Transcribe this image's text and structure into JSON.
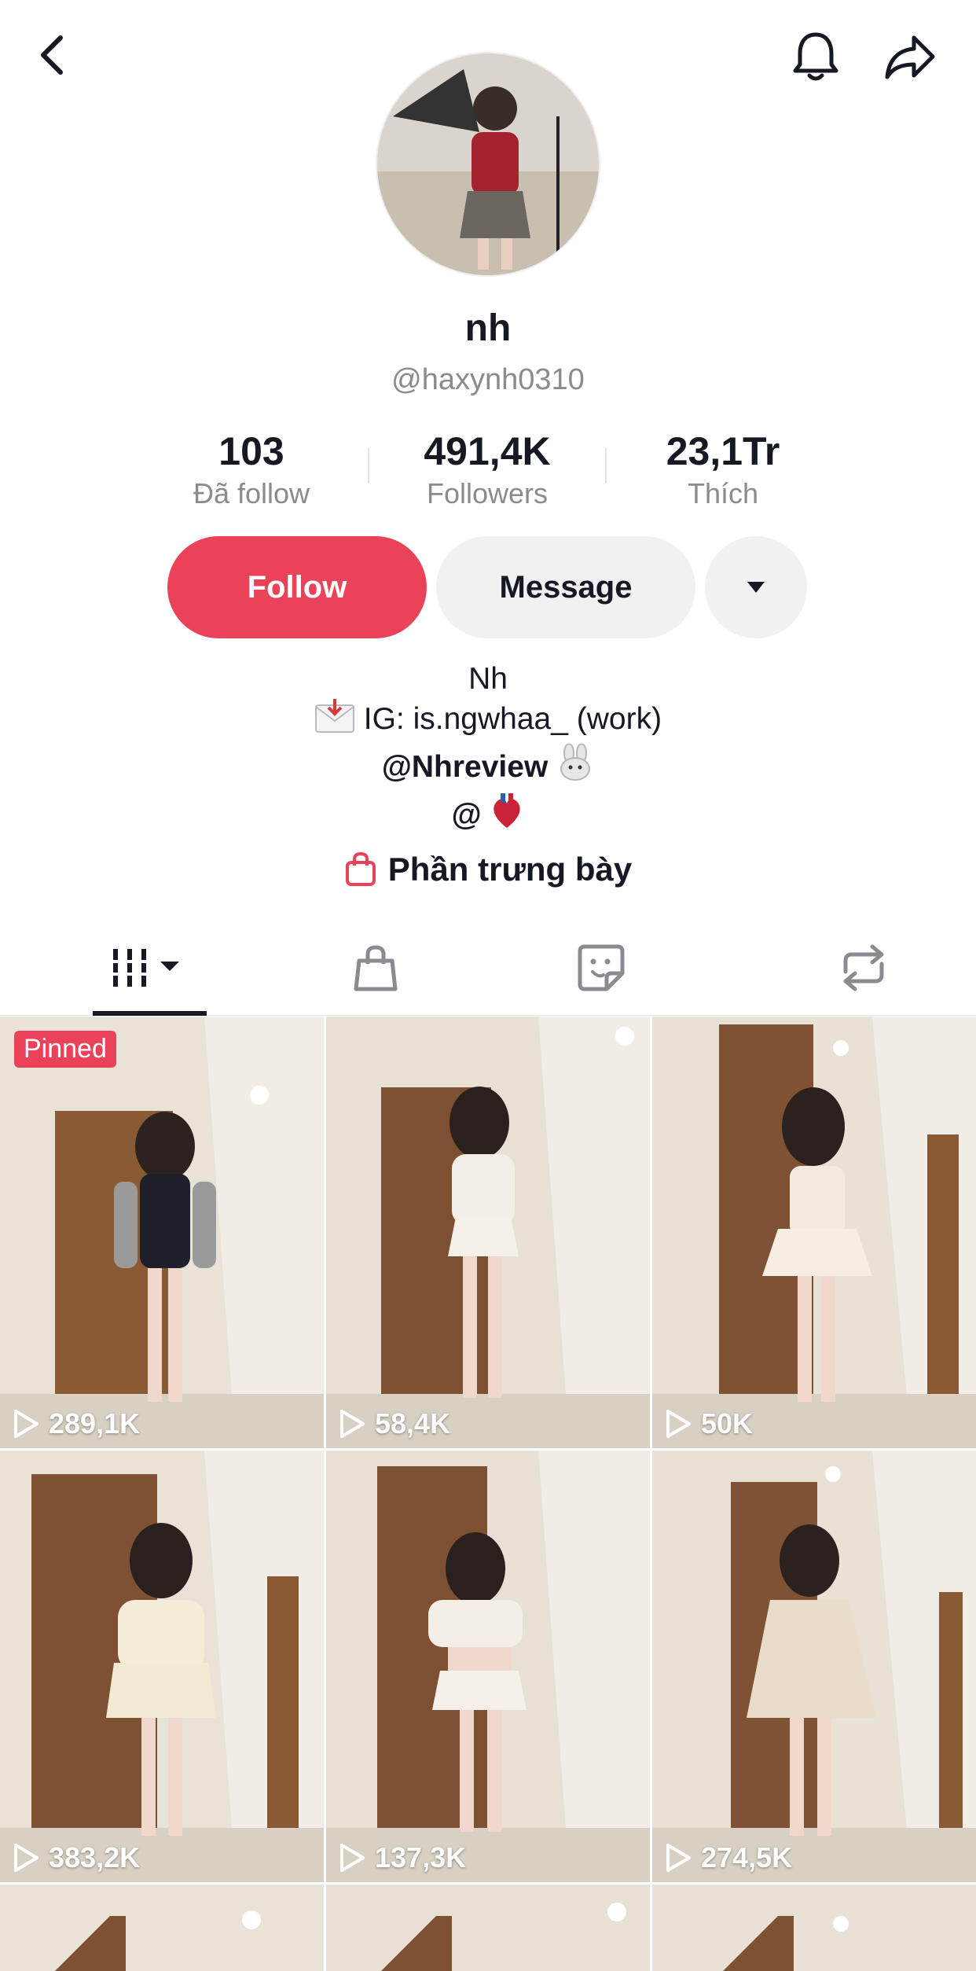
{
  "profile": {
    "name": "nh",
    "handle": "@haxynh0310"
  },
  "stats": [
    {
      "value": "103",
      "label": "Đã follow"
    },
    {
      "value": "491,4K",
      "label": "Followers"
    },
    {
      "value": "23,1Tr",
      "label": "Thích"
    }
  ],
  "actions": {
    "follow": "Follow",
    "message": "Message"
  },
  "bio": {
    "line1": "Nh",
    "line2": "IG: is.ngwhaa_ (work)",
    "line3": "@Nhreview",
    "line4": "@"
  },
  "showcase": "Phần trưng bày",
  "icons": [
    "back-arrow-icon",
    "bell-icon",
    "share-arrow-icon",
    "videos-grid-icon",
    "shopping-bag-icon",
    "sticker-icon",
    "repost-icon",
    "play-icon"
  ],
  "colors": {
    "accent": "#ea4359",
    "muted": "#8a8b91",
    "button_bg": "#f1f1f2"
  },
  "videos": [
    {
      "views": "289,1K",
      "pinned_label": "Pinned"
    },
    {
      "views": "58,4K"
    },
    {
      "views": "50K"
    },
    {
      "views": "383,2K"
    },
    {
      "views": "137,3K"
    },
    {
      "views": "274,5K"
    }
  ]
}
